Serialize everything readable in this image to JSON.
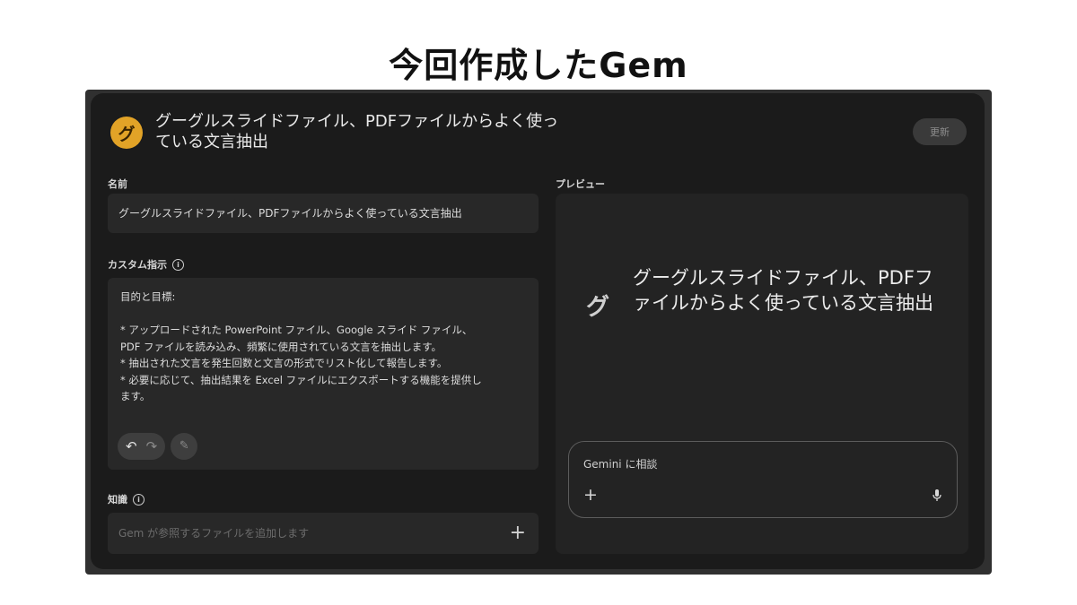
{
  "slide": {
    "title": "今回作成したGem"
  },
  "header": {
    "avatar_letter": "グ",
    "title": "グーグルスライドファイル、PDFファイルからよく使っている文言抽出",
    "update_label": "更新"
  },
  "form": {
    "name_label": "名前",
    "name_value": "グーグルスライドファイル、PDFファイルからよく使っている文言抽出",
    "instructions_label": "カスタム指示",
    "instructions_text": "目的と目標:\n\n* アップロードされた PowerPoint ファイル、Google スライド ファイル、\nPDF ファイルを読み込み、頻繁に使用されている文言を抽出します。\n* 抽出された文言を発生回数と文言の形式でリスト化して報告します。\n* 必要に応じて、抽出結果を Excel ファイルにエクスポートする機能を提供し\nます。",
    "knowledge_label": "知識",
    "knowledge_placeholder": "Gem が参照するファイルを追加します",
    "icons": {
      "info": "info-icon",
      "undo": "undo-icon",
      "redo": "redo-icon",
      "magic": "magic-wand-icon",
      "add": "plus-icon"
    }
  },
  "preview": {
    "label": "プレビュー",
    "avatar_letter": "グ",
    "title": "グーグルスライドファイル、PDFファイルからよく使っている文言抽出",
    "chat_placeholder": "Gemini に相談",
    "icons": {
      "add": "plus-icon",
      "mic": "microphone-icon"
    }
  },
  "colors": {
    "avatar_accent": "#e2a327",
    "window_bg": "#1b1b1b",
    "field_bg": "#282828"
  }
}
